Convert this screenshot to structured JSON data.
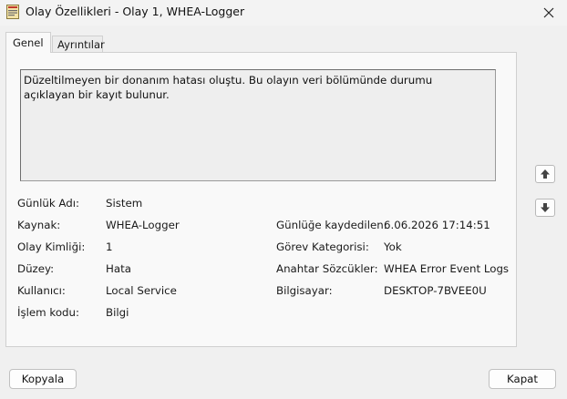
{
  "window": {
    "title": "Olay Özellikleri - Olay 1, WHEA-Logger",
    "app_icon": "event-viewer-icon",
    "close_icon": "close-icon"
  },
  "tabs": [
    {
      "label": "Genel",
      "selected": true
    },
    {
      "label": "Ayrıntılar",
      "selected": false
    }
  ],
  "description": "Düzeltilmeyen bir donanım hatası oluştu. Bu olayın veri bölümünde durumu açıklayan bir kayıt bulunur.",
  "fields": {
    "log_name": {
      "label": "Günlük Adı:",
      "value": "Sistem"
    },
    "source": {
      "label": "Kaynak:",
      "value": "WHEA-Logger"
    },
    "logged": {
      "label": "Günlüğe kaydedilen:",
      "value": "6.06.2026 17:14:51"
    },
    "event_id": {
      "label": "Olay Kimliği:",
      "value": "1"
    },
    "task_category": {
      "label": "Görev Kategorisi:",
      "value": "Yok"
    },
    "level": {
      "label": "Düzey:",
      "value": "Hata"
    },
    "keywords": {
      "label": "Anahtar Sözcükler:",
      "value": "WHEA Error Event Logs"
    },
    "user": {
      "label": "Kullanıcı:",
      "value": "Local Service"
    },
    "computer": {
      "label": "Bilgisayar:",
      "value": "DESKTOP-7BVEE0U"
    },
    "opcode": {
      "label": "İşlem kodu:",
      "value": "Bilgi"
    }
  },
  "nav": {
    "up_icon": "arrow-up-icon",
    "down_icon": "arrow-down-icon"
  },
  "buttons": {
    "copy": "Kopyala",
    "close": "Kapat"
  }
}
